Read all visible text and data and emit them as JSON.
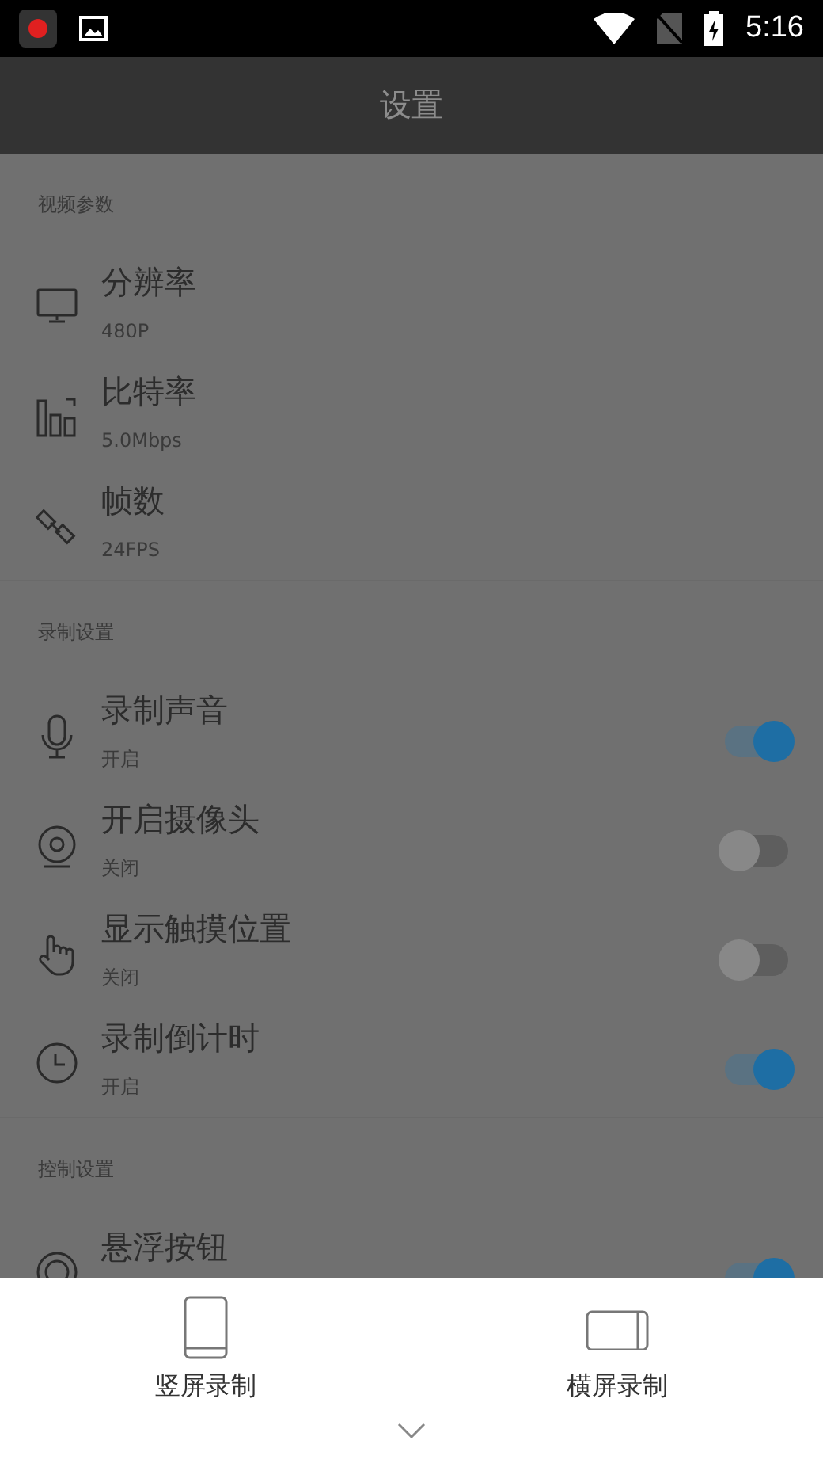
{
  "status_bar": {
    "time": "5:16"
  },
  "app_bar": {
    "title": "设置"
  },
  "sections": [
    {
      "header": "视频参数",
      "items": [
        {
          "kind": "value",
          "title": "分辨率",
          "subtitle": "480P"
        },
        {
          "kind": "value",
          "title": "比特率",
          "subtitle": "5.0Mbps"
        },
        {
          "kind": "value",
          "title": "帧数",
          "subtitle": "24FPS"
        }
      ]
    },
    {
      "header": "录制设置",
      "items": [
        {
          "kind": "toggle",
          "title": "录制声音",
          "subtitle": "开启",
          "on": true
        },
        {
          "kind": "toggle",
          "title": "开启摄像头",
          "subtitle": "关闭",
          "on": false
        },
        {
          "kind": "toggle",
          "title": "显示触摸位置",
          "subtitle": "关闭",
          "on": false
        },
        {
          "kind": "toggle",
          "title": "录制倒计时",
          "subtitle": "开启",
          "on": true
        }
      ]
    },
    {
      "header": "控制设置",
      "items": [
        {
          "kind": "toggle",
          "title": "悬浮按钮",
          "on": true
        }
      ]
    }
  ],
  "bottom_sheet": {
    "options": [
      {
        "label": "竖屏录制"
      },
      {
        "label": "横屏录制"
      }
    ]
  }
}
